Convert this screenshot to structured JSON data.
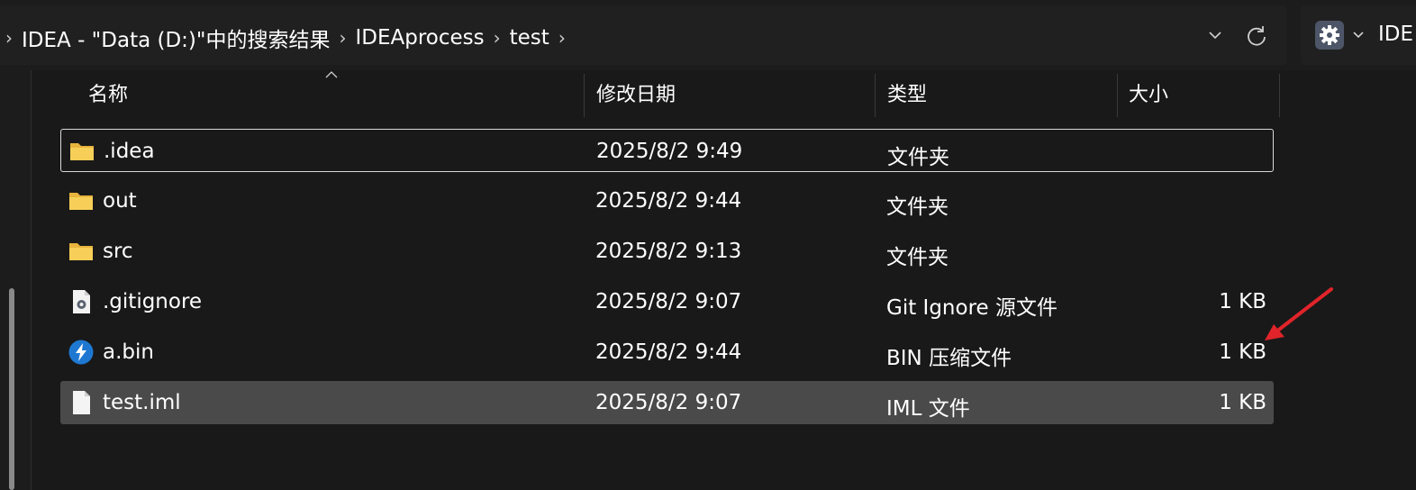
{
  "breadcrumb": {
    "items": [
      "IDEA - \"Data (D:)\"中的搜索结果",
      "IDEAprocess",
      "test"
    ]
  },
  "search": {
    "text": "IDE"
  },
  "columns": {
    "name": "名称",
    "modified": "修改日期",
    "type": "类型",
    "size": "大小"
  },
  "files": [
    {
      "name": ".idea",
      "modified": "2025/8/2 9:49",
      "type": "文件夹",
      "size": "",
      "icon": "folder-icon",
      "state": "focused"
    },
    {
      "name": "out",
      "modified": "2025/8/2 9:44",
      "type": "文件夹",
      "size": "",
      "icon": "folder-icon",
      "state": ""
    },
    {
      "name": "src",
      "modified": "2025/8/2 9:13",
      "type": "文件夹",
      "size": "",
      "icon": "folder-icon",
      "state": ""
    },
    {
      "name": ".gitignore",
      "modified": "2025/8/2 9:07",
      "type": "Git Ignore 源文件",
      "size": "1 KB",
      "icon": "gear-file-icon",
      "state": ""
    },
    {
      "name": "a.bin",
      "modified": "2025/8/2 9:44",
      "type": "BIN 压缩文件",
      "size": "1 KB",
      "icon": "archive-app-icon",
      "state": ""
    },
    {
      "name": "test.iml",
      "modified": "2025/8/2 9:07",
      "type": "IML 文件",
      "size": "1 KB",
      "icon": "document-icon",
      "state": "selected"
    }
  ],
  "colors": {
    "background": "#191919",
    "selected_row": "#4a4a4a",
    "folder": "#f2c94c",
    "annotation_arrow": "#e0242a",
    "archive_icon": "#1e78d2"
  }
}
